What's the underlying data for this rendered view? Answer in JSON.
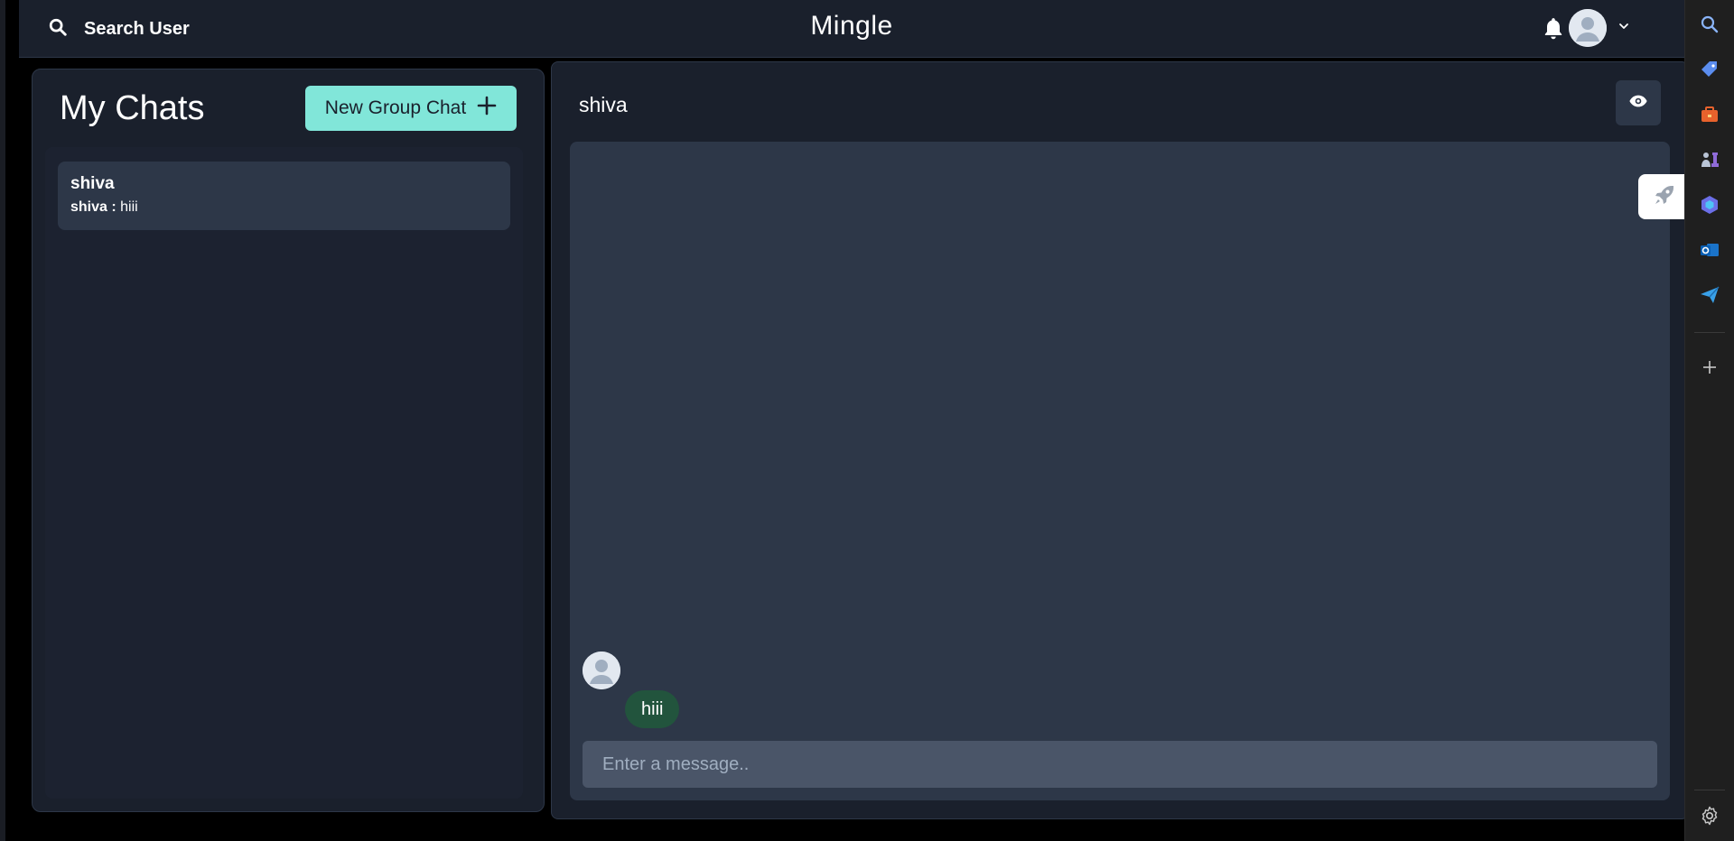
{
  "editor": {
    "stray_text": "/*"
  },
  "header": {
    "search_label": "Search User",
    "brand": "Mingle"
  },
  "chats_panel": {
    "title": "My Chats",
    "new_group_label": "New Group Chat",
    "items": [
      {
        "name": "shiva",
        "preview_sender": "shiva :",
        "preview_text": "hiii"
      }
    ]
  },
  "chat_window": {
    "contact_name": "shiva",
    "messages": [
      {
        "text": "hiii",
        "bubble_color": "#22543d"
      }
    ],
    "input_placeholder": "Enter a message.."
  },
  "colors": {
    "accent": "#81e6d9",
    "panel_bg": "#1a202c",
    "message_area_bg": "#2d3748",
    "input_bg": "#4a5568"
  },
  "right_sidebar": {
    "icons": [
      "search-icon",
      "tag-icon",
      "briefcase-icon",
      "chess-icon",
      "copilot-icon",
      "outlook-icon",
      "send-icon",
      "plus-icon",
      "gear-icon"
    ]
  }
}
